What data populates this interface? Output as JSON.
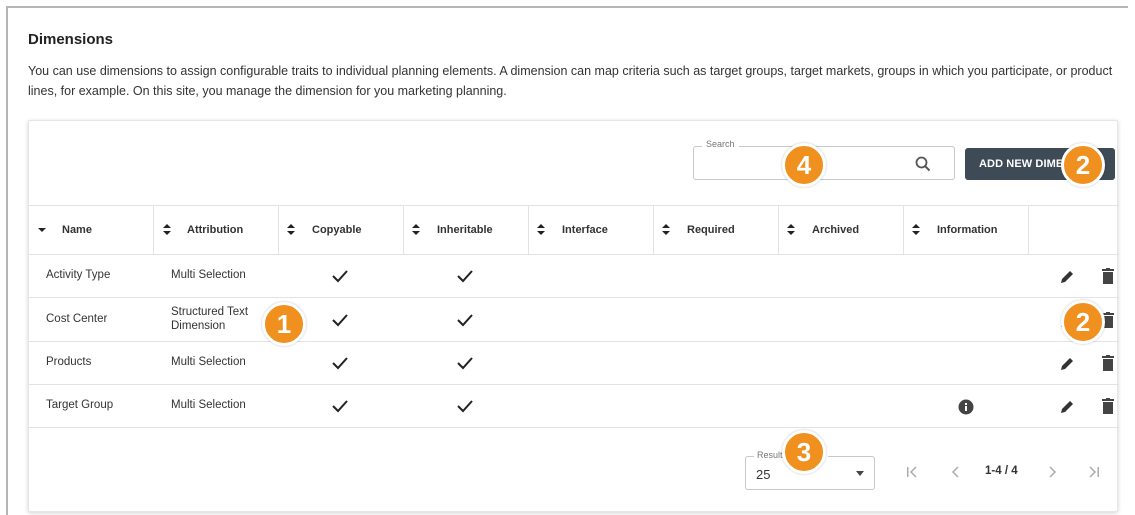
{
  "page": {
    "title": "Dimensions",
    "description": "You can use dimensions to assign configurable traits to individual planning elements. A dimension can map criteria such as target groups, target markets, groups in which you participate, or product lines, for example. On this site, you manage the dimension for you marketing planning."
  },
  "toolbar": {
    "search_label": "Search",
    "search_value": "",
    "add_button_label": "ADD NEW DIMENSION"
  },
  "table": {
    "columns": [
      "Name",
      "Attribution",
      "Copyable",
      "Inheritable",
      "Interface",
      "Required",
      "Archived",
      "Information"
    ],
    "rows": [
      {
        "name": "Activity Type",
        "attribution": "Multi Selection",
        "copyable": true,
        "inheritable": true,
        "information": false
      },
      {
        "name": "Cost Center",
        "attribution_line1": "Structured Text",
        "attribution_line2": "Dimension",
        "copyable": true,
        "inheritable": true,
        "information": false
      },
      {
        "name": "Products",
        "attribution": "Multi Selection",
        "copyable": true,
        "inheritable": true,
        "information": false
      },
      {
        "name": "Target Group",
        "attribution": "Multi Selection",
        "copyable": true,
        "inheritable": true,
        "information": true
      }
    ]
  },
  "pagination": {
    "results_label": "Results per page",
    "results_value": "25",
    "range": "1-4 / 4"
  },
  "callouts": [
    "1",
    "2",
    "2",
    "3",
    "4"
  ],
  "colors": {
    "callout": "#f0901e",
    "button": "#3e4a56"
  },
  "icons": [
    "search-icon",
    "sort-icon",
    "check-icon",
    "edit-icon",
    "delete-icon",
    "info-icon",
    "first-page-icon",
    "prev-page-icon",
    "next-page-icon",
    "last-page-icon"
  ]
}
